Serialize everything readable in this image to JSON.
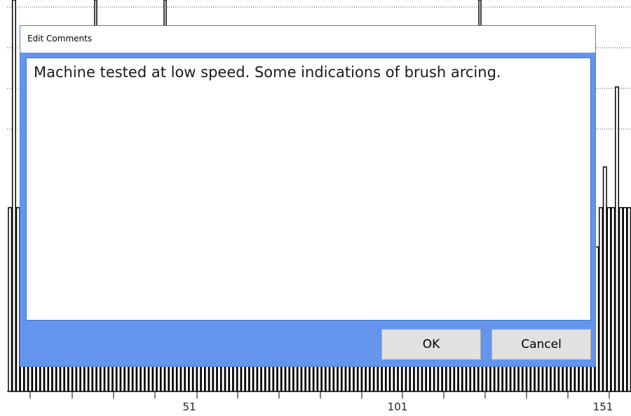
{
  "dialog": {
    "title": "Edit Comments",
    "comment_text": "Machine tested at low speed. Some indications of brush arcing.",
    "ok_label": "OK",
    "cancel_label": "Cancel"
  },
  "colors": {
    "dialog_background": "#6495ed",
    "bar_stroke": "#000000"
  },
  "chart_data": {
    "type": "bar",
    "x_range": [
      1,
      155
    ],
    "x_tick_labels": [
      "51",
      "101",
      "151"
    ],
    "x_tick_values": [
      51,
      101,
      151
    ],
    "grid": "horizontal dotted",
    "visible_values": [
      {
        "x": 1,
        "level": "mid"
      },
      {
        "x": 2,
        "level": "full"
      },
      {
        "x": 143,
        "level": "mid"
      },
      {
        "x": 144,
        "level": "mid"
      },
      {
        "x": 145,
        "level": "low"
      },
      {
        "x": 146,
        "level": "low"
      },
      {
        "x": 147,
        "level": "low"
      },
      {
        "x": 148,
        "level": "mid"
      },
      {
        "x": 149,
        "level": "high"
      },
      {
        "x": 150,
        "level": "mid"
      },
      {
        "x": 151,
        "level": "mid"
      },
      {
        "x": 152,
        "level": "tall"
      },
      {
        "x": 153,
        "level": "mid"
      }
    ]
  }
}
